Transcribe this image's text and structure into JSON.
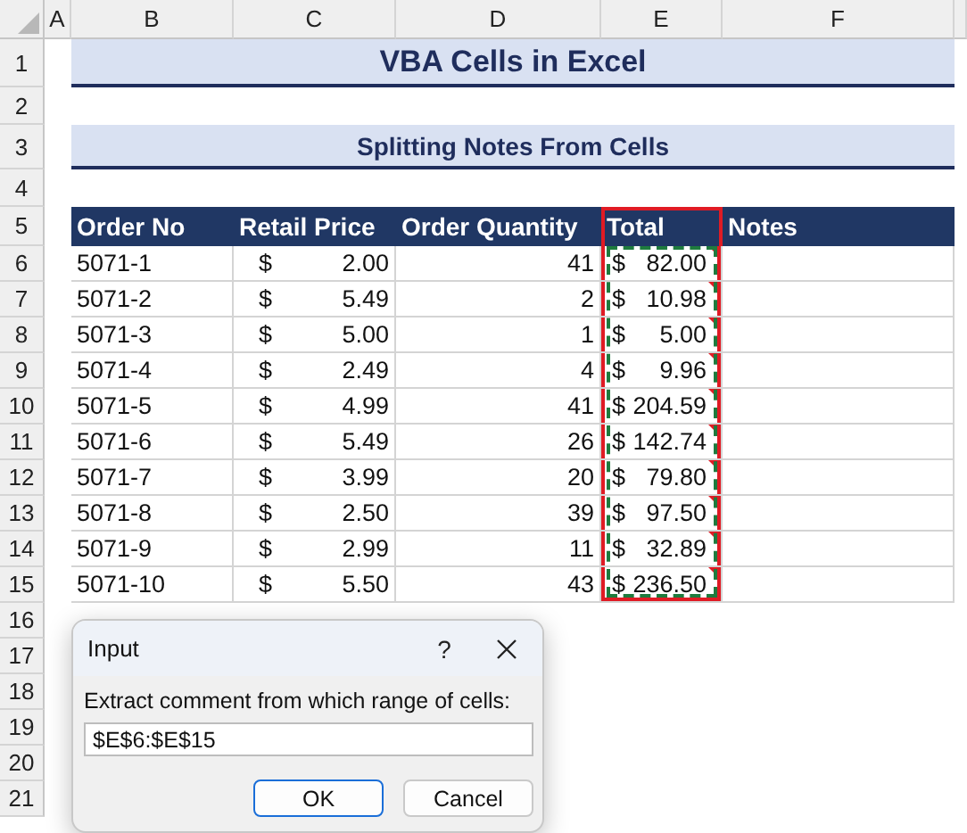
{
  "column_headers": [
    "A",
    "B",
    "C",
    "D",
    "E",
    "F"
  ],
  "row_numbers": [
    "1",
    "2",
    "3",
    "4",
    "5",
    "6",
    "7",
    "8",
    "9",
    "10",
    "11",
    "12",
    "13",
    "14",
    "15",
    "16",
    "17",
    "18",
    "19",
    "20",
    "21"
  ],
  "title": "VBA Cells in Excel",
  "subtitle": "Splitting Notes From Cells",
  "table": {
    "columns": [
      {
        "label": "Order No",
        "highlighted": false
      },
      {
        "label": "Retail Price",
        "highlighted": false
      },
      {
        "label": "Order Quantity",
        "highlighted": false
      },
      {
        "label": "Total",
        "highlighted": true
      },
      {
        "label": "Notes",
        "highlighted": false
      }
    ],
    "rows": [
      {
        "order_no": "5071-1",
        "price_currency": "$",
        "retail_price": "2.00",
        "quantity": "41",
        "total_currency": "$",
        "total": "82.00",
        "note": true
      },
      {
        "order_no": "5071-2",
        "price_currency": "$",
        "retail_price": "5.49",
        "quantity": "2",
        "total_currency": "$",
        "total": "10.98",
        "note": true
      },
      {
        "order_no": "5071-3",
        "price_currency": "$",
        "retail_price": "5.00",
        "quantity": "1",
        "total_currency": "$",
        "total": "5.00",
        "note": true
      },
      {
        "order_no": "5071-4",
        "price_currency": "$",
        "retail_price": "2.49",
        "quantity": "4",
        "total_currency": "$",
        "total": "9.96",
        "note": true
      },
      {
        "order_no": "5071-5",
        "price_currency": "$",
        "retail_price": "4.99",
        "quantity": "41",
        "total_currency": "$",
        "total": "204.59",
        "note": true
      },
      {
        "order_no": "5071-6",
        "price_currency": "$",
        "retail_price": "5.49",
        "quantity": "26",
        "total_currency": "$",
        "total": "142.74",
        "note": true
      },
      {
        "order_no": "5071-7",
        "price_currency": "$",
        "retail_price": "3.99",
        "quantity": "20",
        "total_currency": "$",
        "total": "79.80",
        "note": true
      },
      {
        "order_no": "5071-8",
        "price_currency": "$",
        "retail_price": "2.50",
        "quantity": "39",
        "total_currency": "$",
        "total": "97.50",
        "note": true
      },
      {
        "order_no": "5071-9",
        "price_currency": "$",
        "retail_price": "2.99",
        "quantity": "11",
        "total_currency": "$",
        "total": "32.89",
        "note": true
      },
      {
        "order_no": "5071-10",
        "price_currency": "$",
        "retail_price": "5.50",
        "quantity": "43",
        "total_currency": "$",
        "total": "236.50",
        "note": true
      }
    ]
  },
  "dialog": {
    "title": "Input",
    "help": "?",
    "prompt": "Extract comment from which range of cells:",
    "value": "$E$6:$E$15",
    "buttons": [
      {
        "label": "OK",
        "default": true
      },
      {
        "label": "Cancel",
        "default": false
      }
    ]
  }
}
